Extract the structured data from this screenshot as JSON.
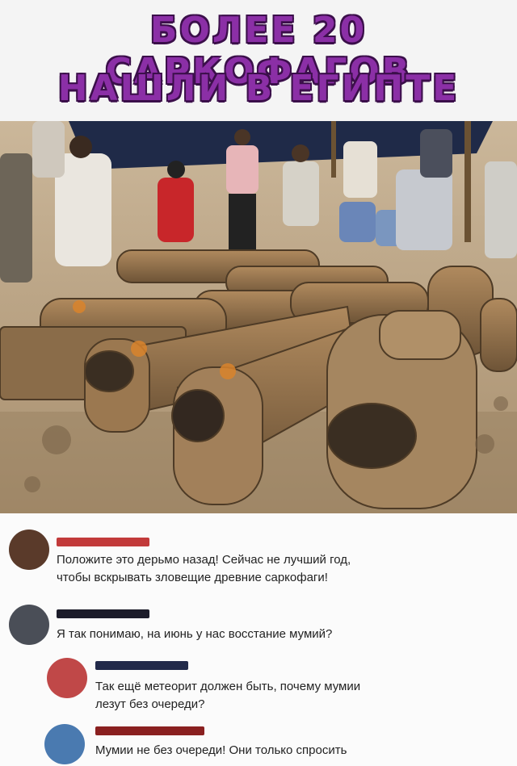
{
  "headline": {
    "line1": "БОЛЕЕ 20 САРКОФАГОВ",
    "line2": "НАШЛИ В ЕГИПТЕ",
    "color": "#8b2fa6"
  },
  "photo": {
    "subject": "sarcophagi-photo"
  },
  "comments": [
    {
      "avatar_color": "#5a3a2a",
      "name_color": "#c23a3a",
      "lines": [
        "Положите это дерьмо назад! Сейчас не лучший год,",
        "чтобы вскрывать зловещие древние саркофаги!"
      ]
    },
    {
      "avatar_color": "#4a4e57",
      "name_color": "#1c1c2a",
      "lines": [
        "Я так понимаю, на июнь у нас восстание мумий?"
      ]
    },
    {
      "avatar_color": "#c04848",
      "name_color": "#222a4a",
      "lines": [
        "Так ещё метеорит должен быть, почему мумии",
        "лезут без очереди?"
      ]
    },
    {
      "avatar_color": "#4a7ab0",
      "name_color": "#8a2020",
      "lines": [
        "Мумии не без очереди! Они только спросить"
      ]
    }
  ]
}
